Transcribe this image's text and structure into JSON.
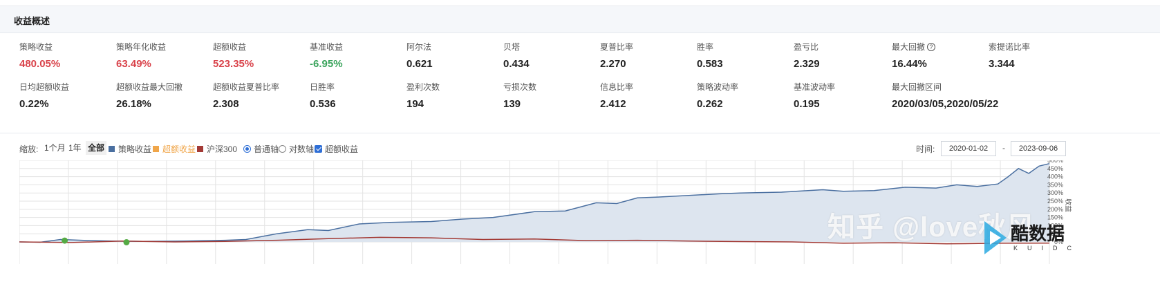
{
  "section_title": "收益概述",
  "stats_row1": [
    {
      "label": "策略收益",
      "value": "480.05%",
      "color": "red"
    },
    {
      "label": "策略年化收益",
      "value": "63.49%",
      "color": "red"
    },
    {
      "label": "超额收益",
      "value": "523.35%",
      "color": "red"
    },
    {
      "label": "基准收益",
      "value": "-6.95%",
      "color": "green"
    },
    {
      "label": "阿尔法",
      "value": "0.621",
      "color": "dark"
    },
    {
      "label": "贝塔",
      "value": "0.434",
      "color": "dark"
    },
    {
      "label": "夏普比率",
      "value": "2.270",
      "color": "dark"
    },
    {
      "label": "胜率",
      "value": "0.583",
      "color": "dark"
    },
    {
      "label": "盈亏比",
      "value": "2.329",
      "color": "dark"
    },
    {
      "label": "最大回撤",
      "value": "16.44%",
      "color": "dark",
      "help": "?"
    },
    {
      "label": "索提诺比率",
      "value": "3.344",
      "color": "dark"
    }
  ],
  "stats_row2": [
    {
      "label": "日均超额收益",
      "value": "0.22%"
    },
    {
      "label": "超额收益最大回撤",
      "value": "26.18%"
    },
    {
      "label": "超额收益夏普比率",
      "value": "2.308"
    },
    {
      "label": "日胜率",
      "value": "0.536"
    },
    {
      "label": "盈利次数",
      "value": "194"
    },
    {
      "label": "亏损次数",
      "value": "139"
    },
    {
      "label": "信息比率",
      "value": "2.412"
    },
    {
      "label": "策略波动率",
      "value": "0.262"
    },
    {
      "label": "基准波动率",
      "value": "0.195"
    },
    {
      "label": "最大回撤区间",
      "value": "2020/03/05,2020/05/22"
    }
  ],
  "toolbar": {
    "zoom_label": "缩放:",
    "zoom_1m": "1个月",
    "zoom_1y": "1年",
    "zoom_all": "全部",
    "legend_strategy": "策略收益",
    "legend_excess": "超额收益",
    "legend_benchmark": "沪深300",
    "axis_normal": "普通轴",
    "axis_log": "对数轴",
    "excess_checkbox": "超额收益",
    "time_label": "时间:",
    "date_from": "2020-01-02",
    "date_sep": "-",
    "date_to": "2023-09-06"
  },
  "colors": {
    "strategy": "#4a6fa0",
    "excess": "#f0a64a",
    "benchmark": "#a33a35",
    "fill": "#dde5ef",
    "grid": "#e3e3e3",
    "marker": "#55aa44"
  },
  "chart_data": {
    "type": "line",
    "y_ticks": [
      "500%",
      "450%",
      "400%",
      "350%",
      "300%",
      "250%",
      "200%",
      "150%",
      "100%",
      "50%",
      "0%"
    ],
    "y_axis_label": "收益",
    "ylim": [
      0,
      500
    ],
    "x_range": [
      "2020-01-02",
      "2023-09-06"
    ],
    "grid": true,
    "series": [
      {
        "name": "策略收益",
        "t": [
          0,
          0.02,
          0.04,
          0.07,
          0.09,
          0.12,
          0.16,
          0.2,
          0.22,
          0.25,
          0.28,
          0.3,
          0.33,
          0.36,
          0.4,
          0.43,
          0.46,
          0.5,
          0.53,
          0.56,
          0.58,
          0.6,
          0.62,
          0.65,
          0.68,
          0.7,
          0.74,
          0.78,
          0.8,
          0.83,
          0.86,
          0.89,
          0.91,
          0.93,
          0.95,
          0.96,
          0.97,
          0.98,
          0.99,
          1.0
        ],
        "y": [
          0,
          -2,
          15,
          8,
          5,
          3,
          5,
          10,
          15,
          50,
          75,
          70,
          110,
          120,
          125,
          140,
          150,
          185,
          190,
          240,
          235,
          270,
          275,
          285,
          295,
          300,
          305,
          320,
          310,
          315,
          335,
          330,
          350,
          340,
          355,
          400,
          450,
          420,
          465,
          480
        ]
      },
      {
        "name": "沪深300",
        "t": [
          0,
          0.05,
          0.1,
          0.15,
          0.2,
          0.25,
          0.3,
          0.35,
          0.4,
          0.45,
          0.5,
          0.55,
          0.6,
          0.65,
          0.7,
          0.75,
          0.8,
          0.85,
          0.9,
          0.95,
          1.0
        ],
        "y": [
          0,
          -4,
          5,
          0,
          3,
          10,
          20,
          28,
          25,
          15,
          18,
          8,
          10,
          5,
          2,
          0,
          -8,
          -5,
          -12,
          -8,
          -7
        ]
      }
    ],
    "markers": [
      {
        "t": 0.044,
        "y": 8
      },
      {
        "t": 0.104,
        "y": -2
      }
    ]
  },
  "watermark_text": "知乎 @love秋风",
  "logo": {
    "text": "酷数据",
    "sub": "KUIDC"
  }
}
